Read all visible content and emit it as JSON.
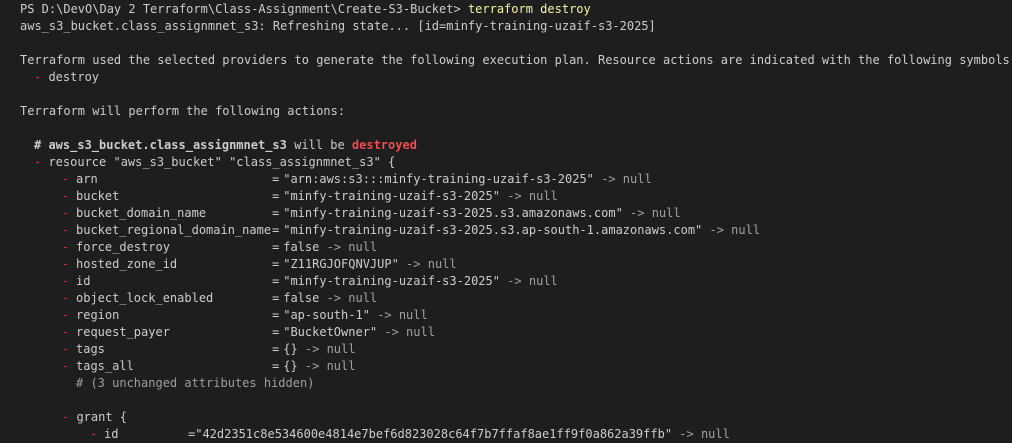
{
  "prompt": {
    "path": "PS D:\\DevO\\Day 2 Terraform\\Class-Assignment\\Create-S3-Bucket> ",
    "command": "terraform destroy"
  },
  "refresh_line": "aws_s3_bucket.class_assignmnet_s3: Refreshing state... [id=minfy-training-uzaif-s3-2025]",
  "intro_line": "Terraform used the selected providers to generate the following execution plan. Resource actions are indicated with the following symbols:",
  "symbol_line": "- destroy",
  "perform_line": "Terraform will perform the following actions:",
  "resource_comment": {
    "prefix": "# aws_s3_bucket.class_assignmnet_s3",
    "middle": " will be ",
    "action": "destroyed"
  },
  "resource_header": "- resource \"aws_s3_bucket\" \"class_assignmnet_s3\" {",
  "attributes": [
    {
      "name": "arn",
      "value": "\"arn:aws:s3:::minfy-training-uzaif-s3-2025\"",
      "suffix": " -> null"
    },
    {
      "name": "bucket",
      "value": "\"minfy-training-uzaif-s3-2025\"",
      "suffix": " -> null"
    },
    {
      "name": "bucket_domain_name",
      "value": "\"minfy-training-uzaif-s3-2025.s3.amazonaws.com\"",
      "suffix": " -> null"
    },
    {
      "name": "bucket_regional_domain_name",
      "value": "\"minfy-training-uzaif-s3-2025.s3.ap-south-1.amazonaws.com\"",
      "suffix": " -> null"
    },
    {
      "name": "force_destroy",
      "value": "false",
      "suffix": " -> null"
    },
    {
      "name": "hosted_zone_id",
      "value": "\"Z11RGJOFQNVJUP\"",
      "suffix": " -> null"
    },
    {
      "name": "id",
      "value": "\"minfy-training-uzaif-s3-2025\"",
      "suffix": " -> null"
    },
    {
      "name": "object_lock_enabled",
      "value": "false",
      "suffix": " -> null"
    },
    {
      "name": "region",
      "value": "\"ap-south-1\"",
      "suffix": " -> null"
    },
    {
      "name": "request_payer",
      "value": "\"BucketOwner\"",
      "suffix": " -> null"
    },
    {
      "name": "tags",
      "value": "{}",
      "suffix": " -> null"
    },
    {
      "name": "tags_all",
      "value": "{}",
      "suffix": " -> null"
    }
  ],
  "hidden_comment": "# (3 unchanged attributes hidden)",
  "grant_header": "- grant {",
  "grant_attr": {
    "name": "id",
    "value": "\"42d2351c8e534600e4814e7bef6d823028c64f7b7ffaf8ae1ff9f0a862a39ffb\"",
    "suffix": " -> null"
  },
  "colors": {
    "background": "#1e1e1e",
    "text": "#cccccc",
    "command": "#f9f1a5",
    "destroyed": "#f14c4c",
    "minus": "#cd3131",
    "null_suffix": "#a0a0a0"
  }
}
